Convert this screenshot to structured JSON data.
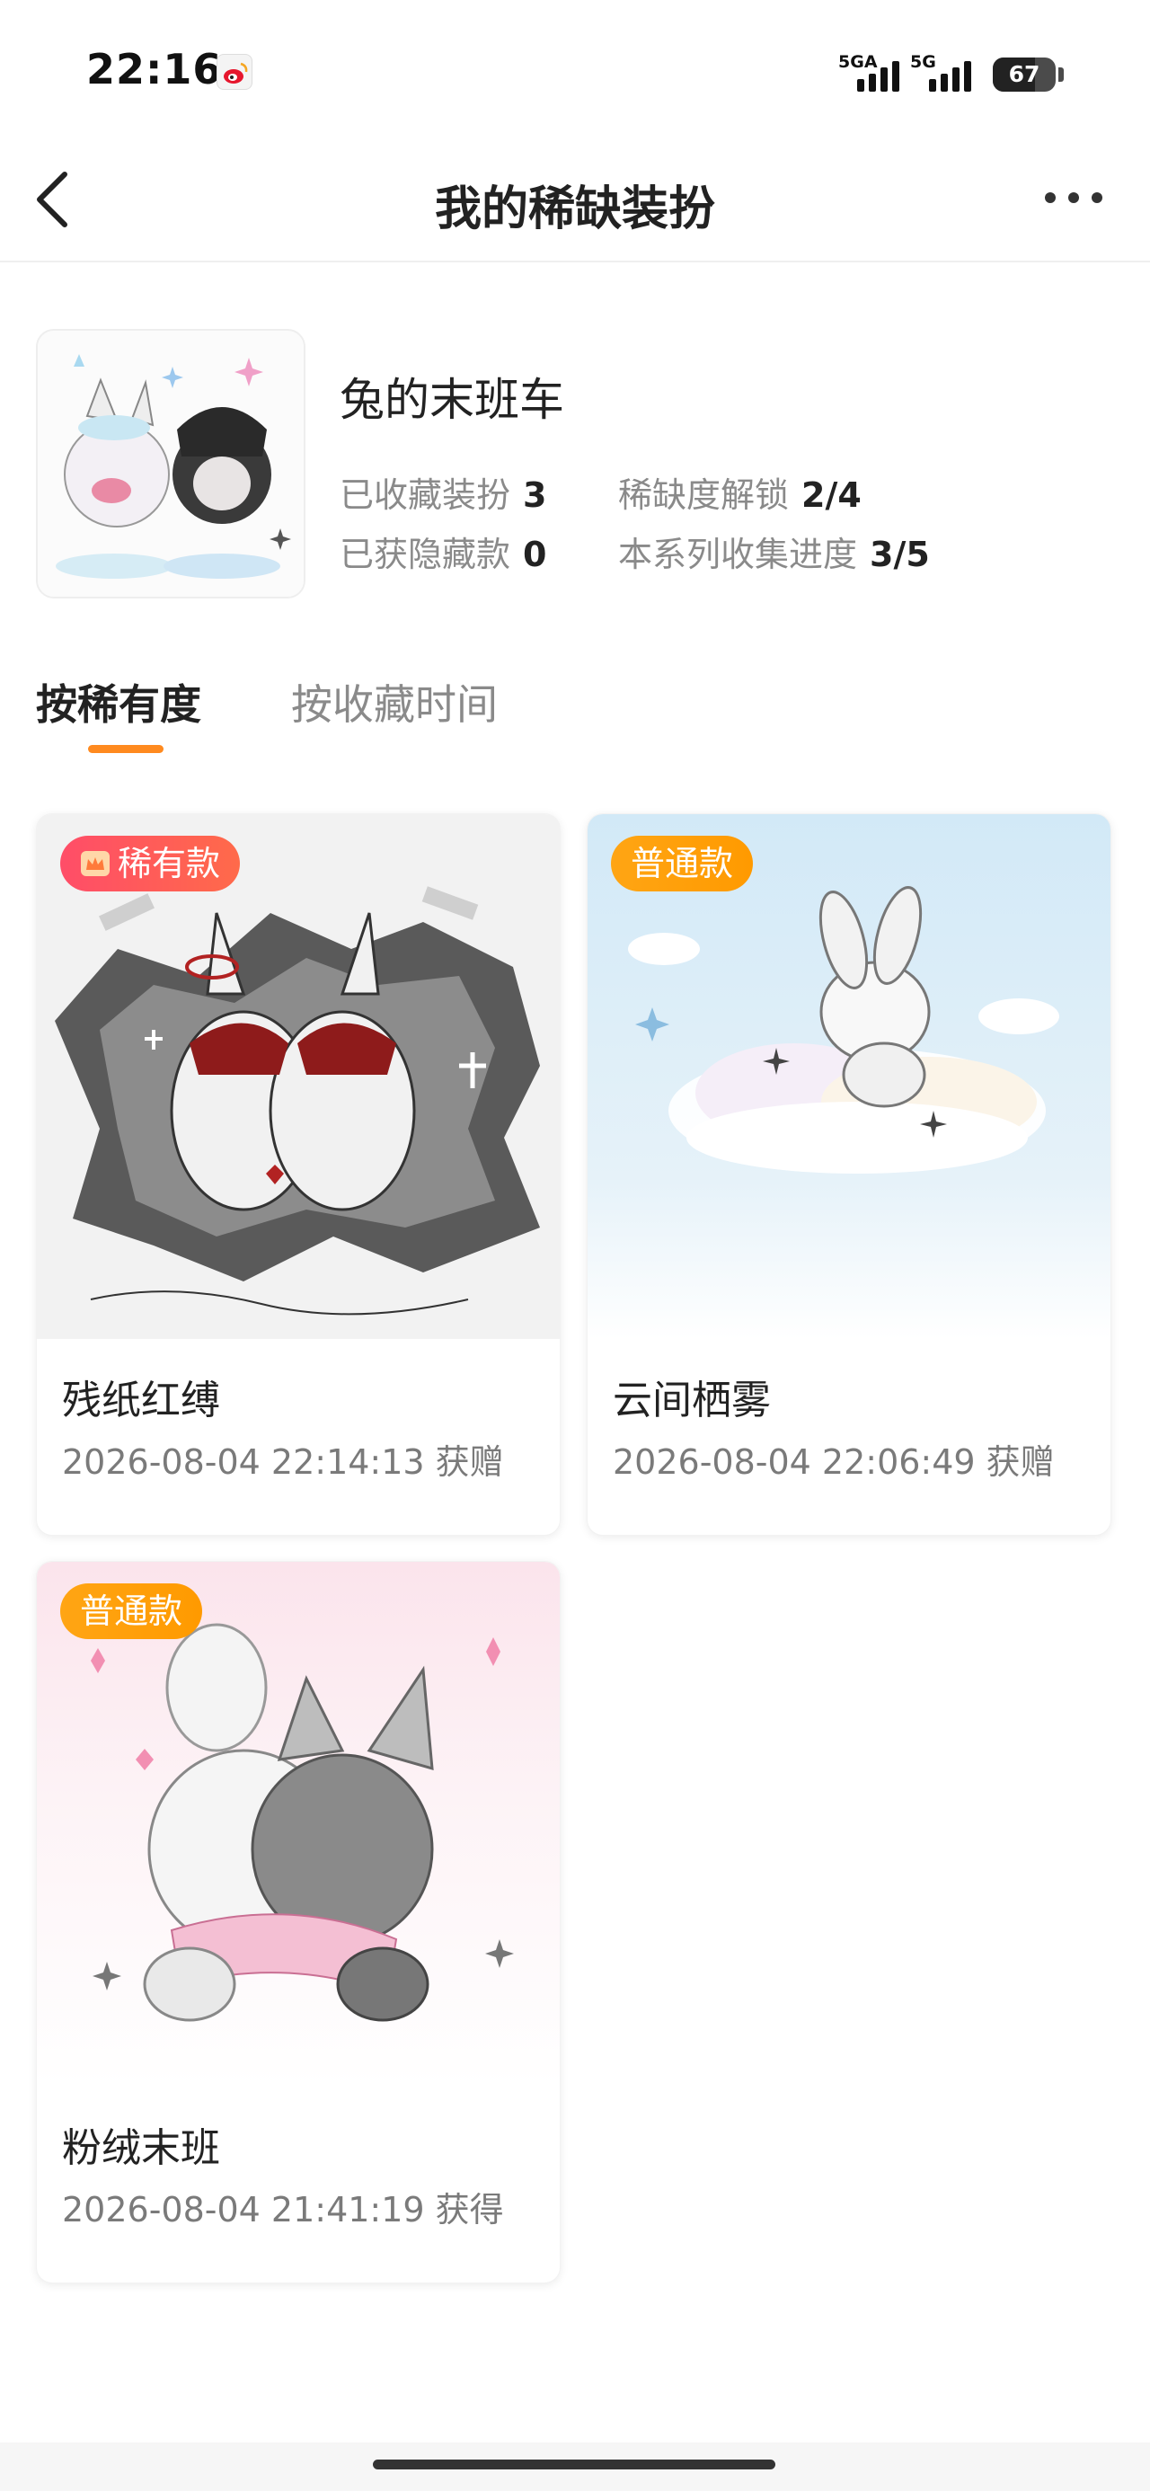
{
  "status_bar": {
    "time": "22:16",
    "network_1": "5GA",
    "network_2": "5G",
    "battery": "67",
    "battery_level_percent": 67,
    "app_icon": "weibo-icon"
  },
  "nav": {
    "title": "我的稀缺装扮",
    "back_icon": "chevron-left-icon",
    "more_icon": "more-dots-icon"
  },
  "profile": {
    "series_name": "兔的末班车",
    "collected_label": "已收藏装扮",
    "collected_value": "3",
    "rarity_unlock_label": "稀缺度解锁",
    "rarity_unlock_value": "2/4",
    "hidden_label": "已获隐藏款",
    "hidden_value": "0",
    "progress_label": "本系列收集进度",
    "progress_value": "3/5"
  },
  "tabs": [
    {
      "label": "按稀有度",
      "active": true
    },
    {
      "label": "按收藏时间",
      "active": false
    }
  ],
  "cards": [
    {
      "badge": "稀有款",
      "badge_type": "rare",
      "title": "残纸红缚",
      "time": "2026-08-04 22:14:13 获赠"
    },
    {
      "badge": "普通款",
      "badge_type": "normal",
      "title": "云间栖雾",
      "time": "2026-08-04 22:06:49 获赠"
    },
    {
      "badge": "普通款",
      "badge_type": "normal",
      "title": "粉绒末班",
      "time": "2026-08-04 21:41:19 获得"
    }
  ],
  "colors": {
    "accent": "#ff8a1f",
    "rare_badge": "#ff4d68",
    "normal_badge": "#ffa514"
  }
}
